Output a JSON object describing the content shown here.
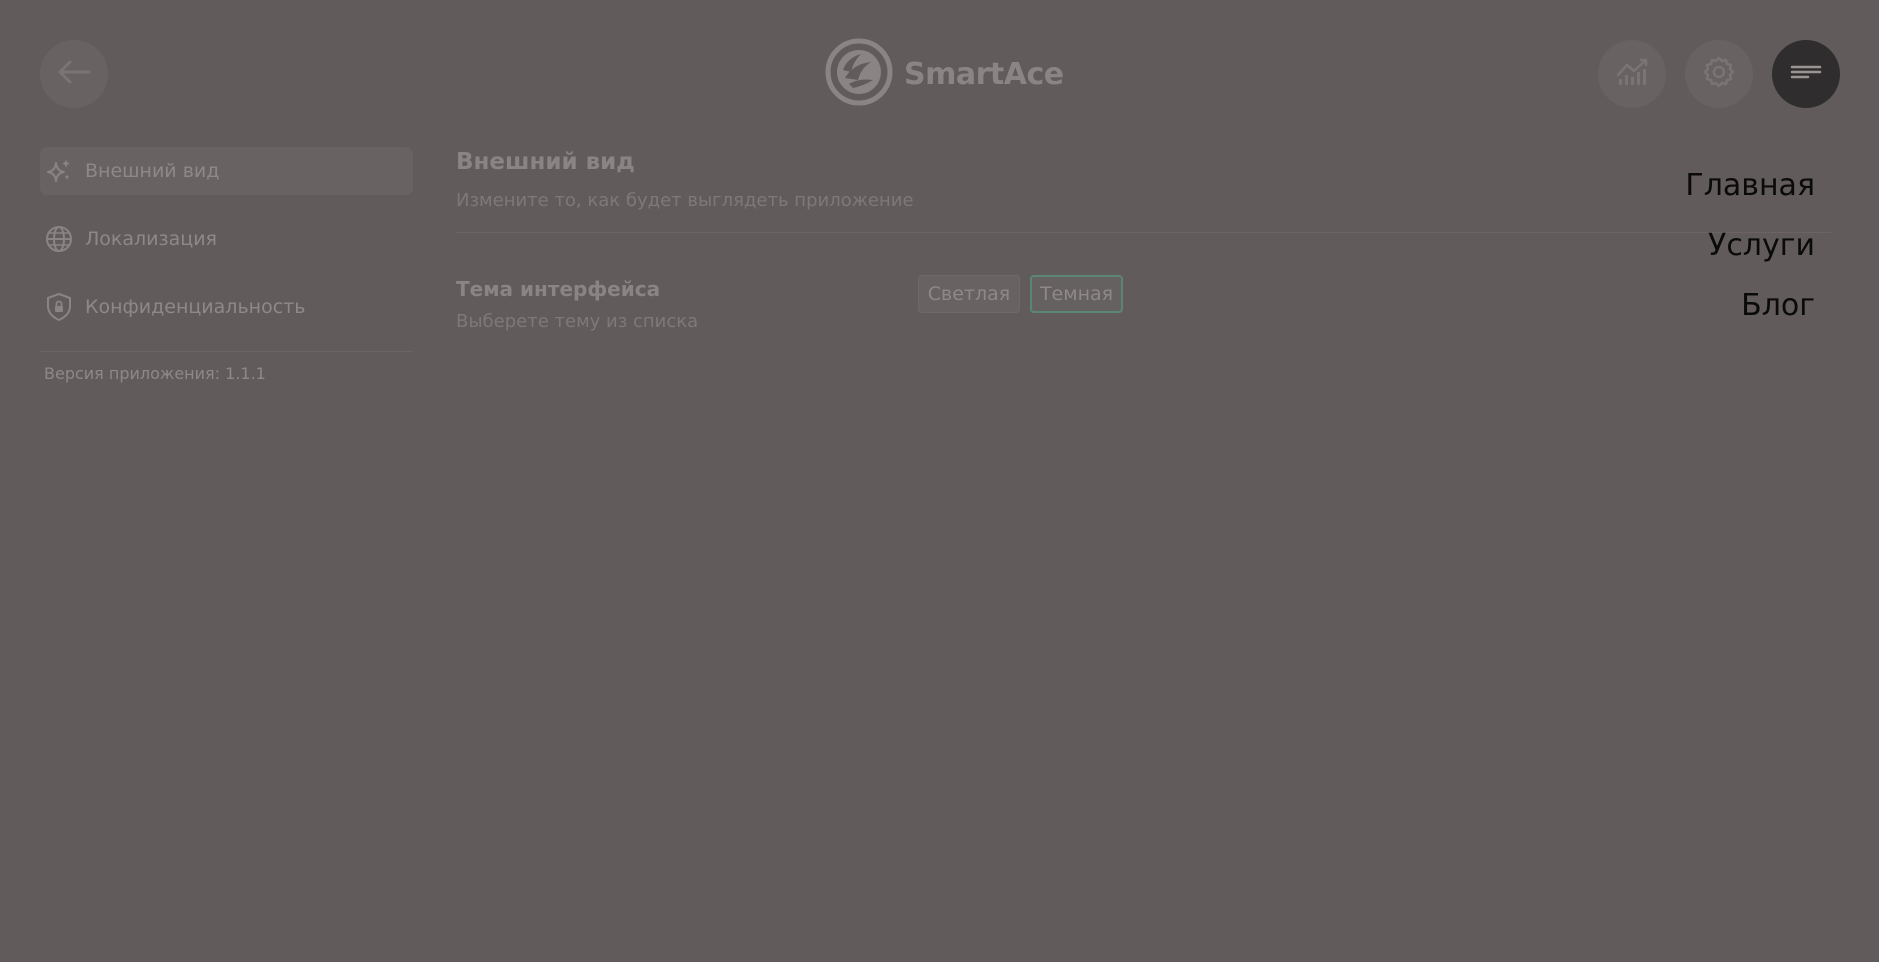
{
  "header": {
    "logo_text": "SmartAce",
    "icons": {
      "back": "arrow-left-icon",
      "stats": "chart-icon",
      "settings": "gear-icon",
      "menu": "menu-lines-icon"
    }
  },
  "sidebar": {
    "items": [
      {
        "label": "Внешний вид",
        "icon": "sparkles-icon",
        "active": true
      },
      {
        "label": "Локализация",
        "icon": "globe-icon",
        "active": false
      },
      {
        "label": "Конфиденциальность",
        "icon": "shield-lock-icon",
        "active": false
      }
    ],
    "version_text": "Версия приложения: 1.1.1"
  },
  "main": {
    "section_title": "Внешний вид",
    "section_subtitle": "Измените то, как будет выглядеть приложение",
    "theme_setting": {
      "title": "Тема интерфейса",
      "subtitle": "Выберете тему из списка",
      "options": [
        "Светлая",
        "Темная"
      ],
      "selected": "Темная"
    }
  },
  "nav_menu": {
    "items": [
      "Главная",
      "Услуги",
      "Блог"
    ]
  },
  "colors": {
    "overlay_background": "#615c5b",
    "selected_accent": "#5b8575",
    "menu_button": "#2f2d2d"
  }
}
